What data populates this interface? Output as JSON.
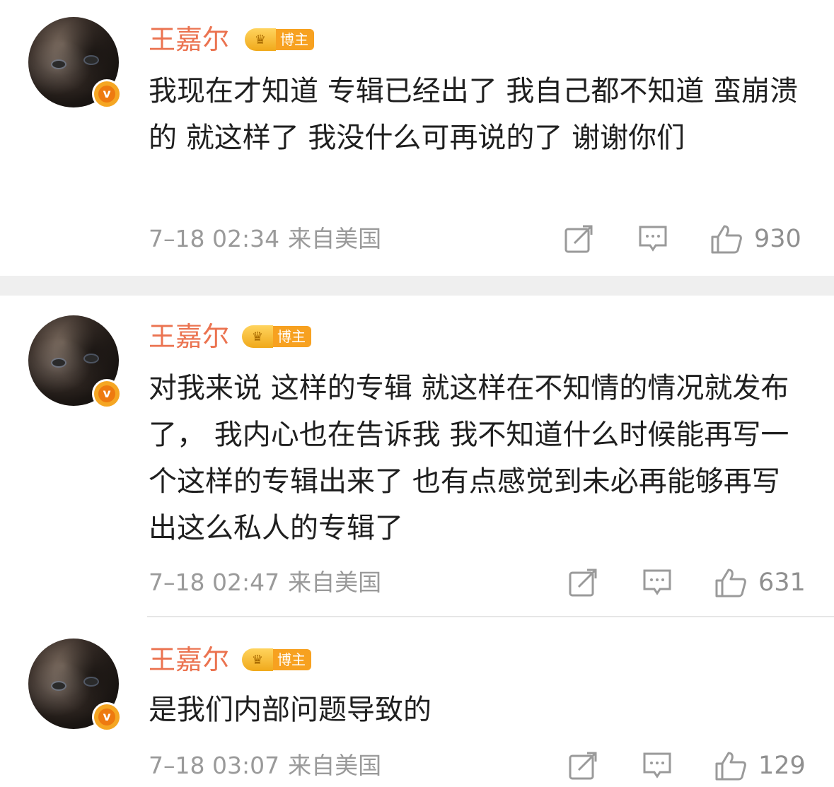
{
  "comments": [
    {
      "user": "王嘉尔",
      "badge": "博主",
      "text": "我现在才知道 专辑已经出了 我自己都不知道 蛮崩溃的 就这样了 我没什么可再说的了 谢谢你们",
      "time": "7–18 02:34",
      "source": "来自美国",
      "likes": "930"
    },
    {
      "user": "王嘉尔",
      "badge": "博主",
      "text": "对我来说 这样的专辑 就这样在不知情的情况就发布了， 我内心也在告诉我 我不知道什么时候能再写一个这样的专辑出来了 也有点感觉到未必再能够再写出这么私人的专辑了",
      "time": "7–18 02:47",
      "source": "来自美国",
      "likes": "631"
    },
    {
      "user": "王嘉尔",
      "badge": "博主",
      "text": "是我们内部问题导致的",
      "time": "7–18 03:07",
      "source": "来自美国",
      "likes": "129"
    }
  ],
  "icons": {
    "verified": "v-verified-icon",
    "crown": "crown-level-icon",
    "share": "share-icon",
    "comment": "comment-icon",
    "like": "thumbs-up-icon"
  },
  "colors": {
    "username": "#eb7350",
    "badge": "#f7a120",
    "meta": "#9a9a9a",
    "separator": "#efefef"
  }
}
